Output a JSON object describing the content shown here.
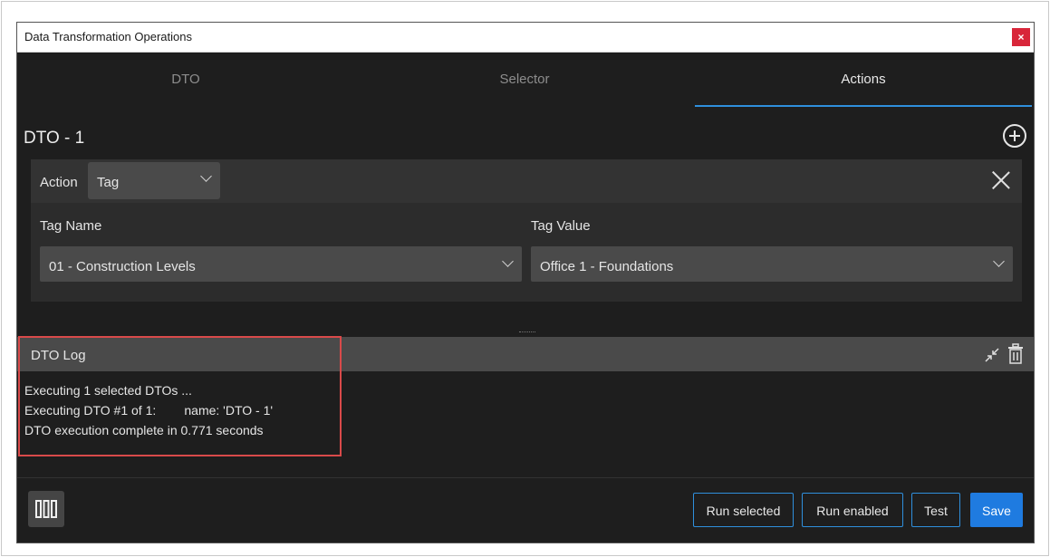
{
  "window": {
    "title": "Data Transformation Operations",
    "close_glyph": "×"
  },
  "tabs": [
    {
      "label": "DTO",
      "active": false
    },
    {
      "label": "Selector",
      "active": false
    },
    {
      "label": "Actions",
      "active": true
    }
  ],
  "dto": {
    "title": "DTO - 1"
  },
  "action": {
    "label": "Action",
    "selected": "Tag",
    "tag_name_label": "Tag Name",
    "tag_name_value": "01 - Construction Levels",
    "tag_value_label": "Tag Value",
    "tag_value_value": "Office 1 - Foundations"
  },
  "log": {
    "title": "DTO Log",
    "lines": [
      "Executing 1 selected DTOs ...",
      "Executing DTO #1 of 1:        name: 'DTO - 1'",
      "DTO execution complete in 0.771 seconds"
    ]
  },
  "buttons": {
    "run_selected": "Run selected",
    "run_enabled": "Run enabled",
    "test": "Test",
    "save": "Save"
  },
  "colors": {
    "accent": "#1f7be0",
    "highlight": "#d94a4a",
    "background": "#1e1e1e"
  }
}
